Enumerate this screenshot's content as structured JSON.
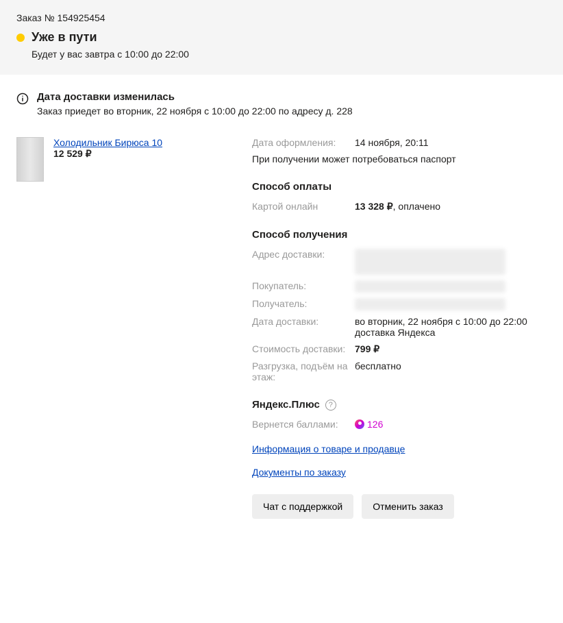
{
  "header": {
    "order_number_label": "Заказ № 154925454",
    "status": "Уже в пути",
    "delivery_hint": "Будет у вас завтра с 10:00 до 22:00"
  },
  "notice": {
    "title": "Дата доставки изменилась",
    "text": "Заказ приедет во вторник, 22 ноября с 10:00 до 22:00 по адресу д. 228"
  },
  "product": {
    "name": "Холодильник Бирюса 10",
    "price": "12 529 ₽"
  },
  "details": {
    "order_date_label": "Дата оформления:",
    "order_date_value": "14 ноября, 20:11",
    "passport_note": "При получении может потребоваться паспорт",
    "payment_section_title": "Способ оплаты",
    "payment_method_label": "Картой онлайн",
    "payment_amount": "13 328 ₽",
    "payment_status": ", оплачено",
    "receipt_section_title": "Способ получения",
    "address_label": "Адрес доставки:",
    "buyer_label": "Покупатель:",
    "recipient_label": "Получатель:",
    "delivery_date_label": "Дата доставки:",
    "delivery_date_value": "во вторник, 22 ноября с 10:00 до 22:00 доставка Яндекса",
    "shipping_cost_label": "Стоимость доставки:",
    "shipping_cost_value": "799 ₽",
    "unloading_label": "Разгрузка, подъём на этаж:",
    "unloading_value": "бесплатно",
    "plus_title": "Яндекс.Плюс",
    "cashback_label": "Вернется баллами:",
    "cashback_value": "126",
    "product_seller_info_link": "Информация о товаре и продавце",
    "documents_link": "Документы по заказу"
  },
  "buttons": {
    "support_chat": "Чат с поддержкой",
    "cancel_order": "Отменить заказ"
  }
}
